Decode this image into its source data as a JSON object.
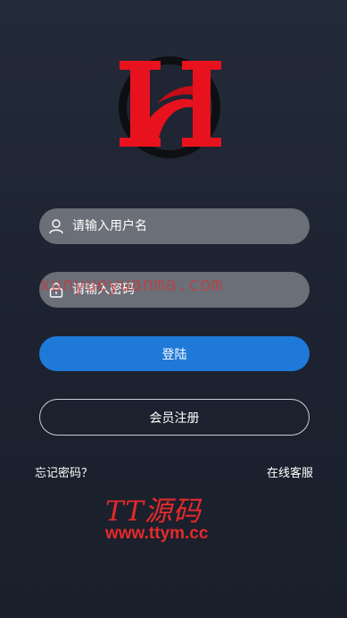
{
  "login": {
    "username_placeholder": "请输入用户名",
    "password_placeholder": "请输入密码",
    "login_button": "登陆",
    "register_button": "会员注册",
    "forgot_password": "忘记密码？",
    "online_service": "在线客服"
  },
  "watermarks": {
    "overlay_text": "xunyueyuanma.com",
    "brand": "TT源码",
    "url": "www.ttym.cc"
  },
  "colors": {
    "accent": "#1e79d9",
    "logo_red": "#e8121e",
    "field_bg": "#6b6f78"
  }
}
